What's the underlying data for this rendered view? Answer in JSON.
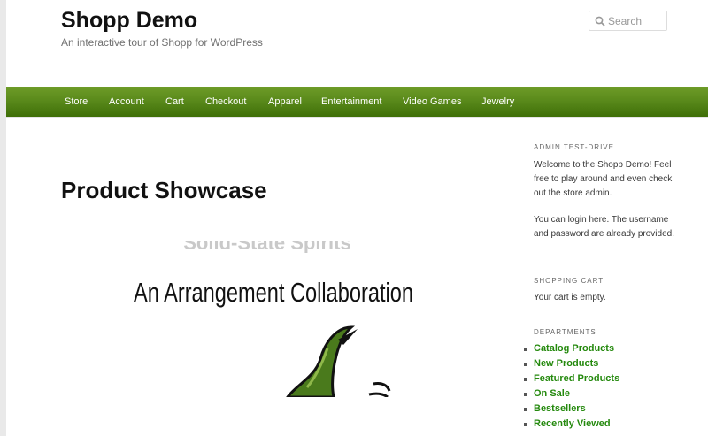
{
  "header": {
    "site_title": "Shopp Demo",
    "tagline": "An interactive tour of Shopp for WordPress",
    "search_placeholder": "Search"
  },
  "nav": {
    "items": [
      "Store",
      "Account",
      "Cart",
      "Checkout",
      "Apparel",
      "Entertainment",
      "Video Games",
      "Jewelry"
    ]
  },
  "main": {
    "title": "Product Showcase",
    "product_image": {
      "top_text": "Solid-State Spirits",
      "title_text": "An Arrangement Collaboration"
    }
  },
  "sidebar": {
    "admin": {
      "title": "ADMIN TEST-DRIVE",
      "text_1": "Welcome to the Shopp Demo! Feel free to play around and even check out the store admin.",
      "text_2_pre": "You can ",
      "login_link": "login here",
      "text_2_post": ". The username and password are already provided."
    },
    "cart": {
      "title": "SHOPPING CART",
      "text": "Your cart is empty."
    },
    "departments": {
      "title": "DEPARTMENTS",
      "items": [
        "Catalog Products",
        "New Products",
        "Featured Products",
        "On Sale",
        "Bestsellers",
        "Recently Viewed"
      ]
    }
  },
  "colors": {
    "nav_green": "#5a8a1b",
    "link_green": "#24890d"
  }
}
